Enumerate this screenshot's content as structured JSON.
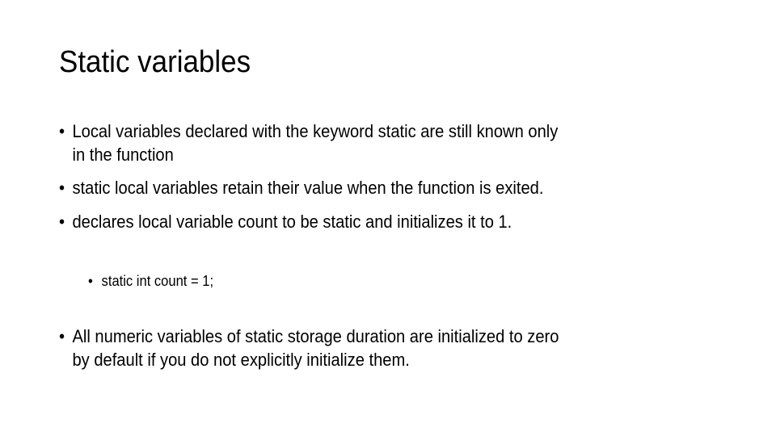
{
  "slide": {
    "title": "Static variables",
    "bullet_glyph": "•",
    "bullets": [
      {
        "lines": [
          "Local variables declared with the keyword static are still known only",
          "in the function"
        ]
      },
      {
        "lines": [
          "static local variables retain their value when the function is exited."
        ]
      },
      {
        "lines": [
          "declares local variable count to be static and initializes it to 1."
        ]
      },
      {
        "level": 2,
        "lines": [
          "static int count = 1;"
        ]
      },
      {
        "lines": [
          "All numeric variables of static storage duration are initialized to zero",
          "by default if you do not explicitly initialize them."
        ]
      }
    ]
  }
}
